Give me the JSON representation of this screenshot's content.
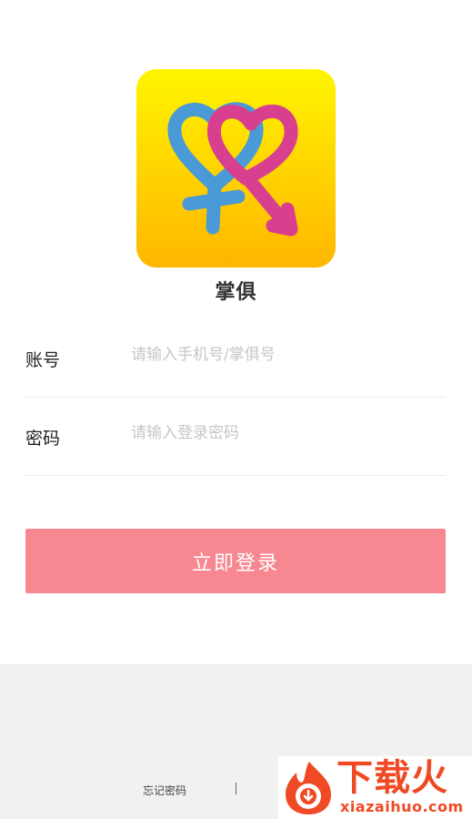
{
  "app": {
    "name": "掌俱",
    "icon": "intertwined-gender-hearts-icon"
  },
  "form": {
    "account": {
      "label": "账号",
      "placeholder": "请输入手机号/掌俱号",
      "value": ""
    },
    "password": {
      "label": "密码",
      "placeholder": "请输入登录密码",
      "value": ""
    },
    "login_label": "立即登录"
  },
  "footer": {
    "forgot_label": "忘记密码",
    "separator": "|"
  },
  "watermark": {
    "title": "下载火",
    "subtitle": "xiazaihuo.com"
  },
  "colors": {
    "accent": "#f78791",
    "icon_gradient_top": "#fff500",
    "icon_gradient_bottom": "#ffb600",
    "female_symbol": "#4a9ad8",
    "male_symbol": "#d8408f",
    "background_bottom": "#f1f1f1"
  }
}
